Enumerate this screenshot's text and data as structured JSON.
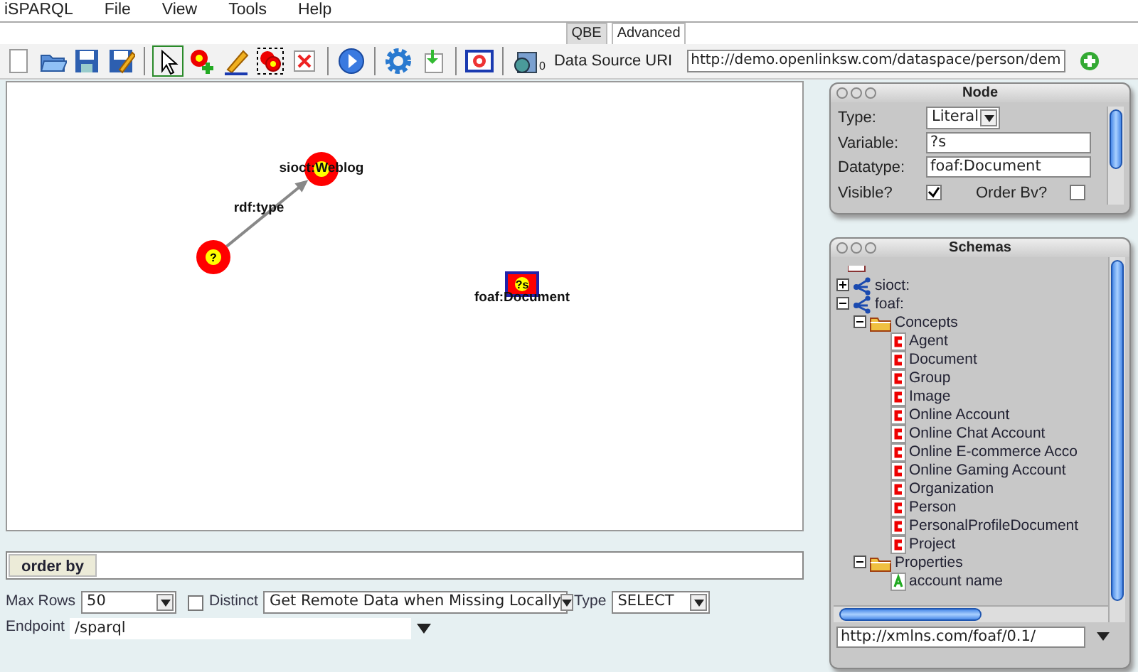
{
  "menu": [
    "iSPARQL",
    "File",
    "View",
    "Tools",
    "Help"
  ],
  "tabs": [
    {
      "label": "QBE",
      "selected": true
    },
    {
      "label": "Advanced",
      "selected": false
    }
  ],
  "toolbar": {
    "tools": [
      {
        "kind": "new",
        "selected": false
      },
      {
        "kind": "open",
        "selected": false
      },
      {
        "kind": "save",
        "selected": false
      },
      {
        "kind": "saveas",
        "selected": false
      },
      {
        "kind": "sep"
      },
      {
        "kind": "pointer",
        "selected": true
      },
      {
        "kind": "addnode",
        "selected": false
      },
      {
        "kind": "pencil",
        "selected": false
      },
      {
        "kind": "group",
        "selected": false
      },
      {
        "kind": "delete",
        "selected": false
      },
      {
        "kind": "sep"
      },
      {
        "kind": "run",
        "selected": false
      },
      {
        "kind": "sep"
      },
      {
        "kind": "gear",
        "selected": false
      },
      {
        "kind": "import",
        "selected": false
      },
      {
        "kind": "sep"
      },
      {
        "kind": "lifebuoy",
        "selected": false
      },
      {
        "kind": "sep"
      }
    ],
    "source_count": "0",
    "source_label": "Data Source URI",
    "source_value": "http://demo.openlinksw.com/dataspace/person/dem"
  },
  "graph": {
    "nodes": [
      {
        "kind": "circle",
        "label": "sioct:Weblog"
      },
      {
        "kind": "circle",
        "inner": "?"
      },
      {
        "kind": "square",
        "inner": "?s",
        "label": "foaf:Document"
      }
    ],
    "edges": [
      {
        "label": "rdf:type"
      }
    ]
  },
  "node_panel": {
    "title": "Node",
    "type_label": "Type:",
    "type_value": "Literal",
    "variable_label": "Variable:",
    "variable_value": "?s",
    "datatype_label": "Datatype:",
    "datatype_value": "foaf:Document",
    "visible_label": "Visible?",
    "visible": true,
    "order_label": "Order Bv?",
    "order": false
  },
  "schemas": {
    "title": "Schemas",
    "tree": [
      {
        "label": "sioct:",
        "kind": "namespace",
        "expanded": false
      },
      {
        "label": "foaf:",
        "kind": "namespace",
        "expanded": true,
        "children": [
          {
            "label": "Concepts",
            "kind": "folder",
            "expanded": true,
            "children": [
              {
                "label": "Agent",
                "kind": "class"
              },
              {
                "label": "Document",
                "kind": "class"
              },
              {
                "label": "Group",
                "kind": "class"
              },
              {
                "label": "Image",
                "kind": "class"
              },
              {
                "label": "Online Account",
                "kind": "class"
              },
              {
                "label": "Online Chat Account",
                "kind": "class"
              },
              {
                "label": "Online E-commerce Acco",
                "kind": "class"
              },
              {
                "label": "Online Gaming Account",
                "kind": "class"
              },
              {
                "label": "Organization",
                "kind": "class"
              },
              {
                "label": "Person",
                "kind": "class"
              },
              {
                "label": "PersonalProfileDocument",
                "kind": "class"
              },
              {
                "label": "Project",
                "kind": "class"
              }
            ]
          },
          {
            "label": "Properties",
            "kind": "folder",
            "expanded": true,
            "children": [
              {
                "label": "account name",
                "kind": "property"
              }
            ]
          }
        ]
      }
    ],
    "uri": "http://xmlns.com/foaf/0.1/"
  },
  "bottom": {
    "order_by": "order by",
    "max_rows_label": "Max Rows",
    "max_rows": "50",
    "distinct": false,
    "distinct_label": "Distinct",
    "remote": "Get Remote Data when Missing Locally",
    "type_label": "Type",
    "type": "SELECT",
    "endpoint_label": "Endpoint",
    "endpoint": "/sparql"
  }
}
